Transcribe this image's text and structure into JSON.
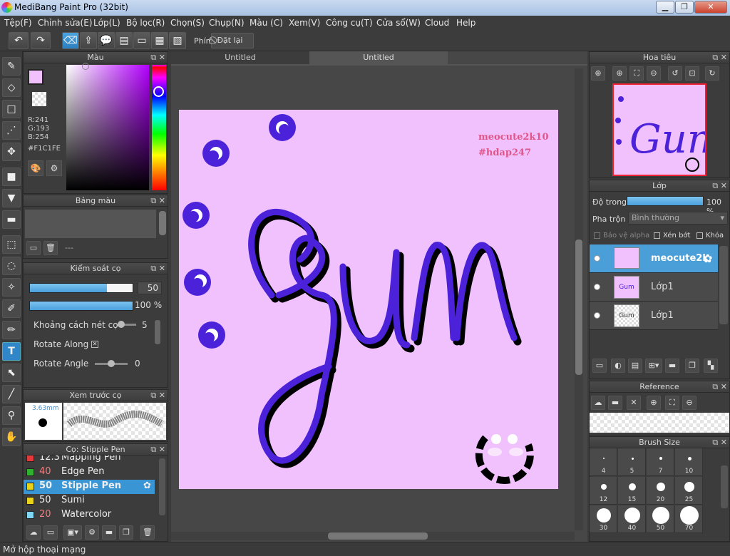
{
  "window": {
    "title": "MediBang Paint Pro (32bit)",
    "min": "▁",
    "max": "❐",
    "close": "✕"
  },
  "menu": [
    "Tệp(F)",
    "Chỉnh sửa(E)",
    "Lớp(L)",
    "Bộ lọc(R)",
    "Chọn(S)",
    "Chụp(N)",
    "Màu (C)",
    "Xem(V)",
    "Công cụ(T)",
    "Cửa sổ(W)",
    "Cloud",
    "Help"
  ],
  "toolbar": {
    "key_label": "Phím",
    "reset_label": "Đặt lại"
  },
  "color_panel": {
    "title": "Màu",
    "r": "R:241",
    "g": "G:193",
    "b": "B:254",
    "hex": "#F1C1FE",
    "primary": "#F1C1FE",
    "secondary": "#000000"
  },
  "palette_panel": {
    "title": "Bảng màu",
    "name": "---"
  },
  "brush_control": {
    "title": "Kiểm soát cọ",
    "size_value": "50",
    "size_level": 0.75,
    "opacity_value": "100 %",
    "opacity_level": 1.0,
    "spacing_label": "Khoảng cách nét cọ",
    "spacing_value": "5",
    "rotate_along_label": "Rotate Along",
    "rotate_along_mark": "✕",
    "rotate_angle_label": "Rotate Angle",
    "rotate_angle_value": "0"
  },
  "brush_preview": {
    "title": "Xem trước cọ",
    "size": "3.63mm"
  },
  "brush_list": {
    "title": "Cọ: Stipple Pen",
    "items": [
      {
        "size": "12.3",
        "name": "Mapping Pen",
        "color": "#e33b3b"
      },
      {
        "size": "40",
        "name": "Edge Pen",
        "color": "#2fb32f"
      },
      {
        "size": "50",
        "name": "Stipple Pen",
        "color": "#e8d21a"
      },
      {
        "size": "50",
        "name": "Sumi",
        "color": "#e8d21a"
      },
      {
        "size": "20",
        "name": "Watercolor",
        "color": "#7fd6f5"
      }
    ]
  },
  "canvas": {
    "tabs": [
      "Untitled",
      "Untitled"
    ],
    "bg": "#F1C1FE",
    "text1": "meocute2k10",
    "text2": "#hdap247",
    "word": "Gum"
  },
  "navigator": {
    "title": "Hoa tiêu"
  },
  "layer_panel": {
    "title": "Lớp",
    "opacity_label": "Độ trong",
    "opacity_value": "100 %",
    "opacity_level": 1.0,
    "blend_label": "Pha trộn",
    "blend_value": "Bình thường",
    "protect_alpha": "Bảo vệ alpha",
    "clipping": "Xén bớt",
    "lock": "Khóa",
    "layers": [
      {
        "name": "meocute2k",
        "selected": true
      },
      {
        "name": "Lớp1",
        "selected": false
      },
      {
        "name": "Lớp1",
        "selected": false
      }
    ]
  },
  "reference_panel": {
    "title": "Reference"
  },
  "brush_size_panel": {
    "title": "Brush Size",
    "sizes": [
      "4",
      "5",
      "7",
      "10",
      "12",
      "15",
      "20",
      "25",
      "30",
      "40",
      "50",
      "70"
    ]
  },
  "status": {
    "text": "Mở hộp thoại mạng"
  }
}
